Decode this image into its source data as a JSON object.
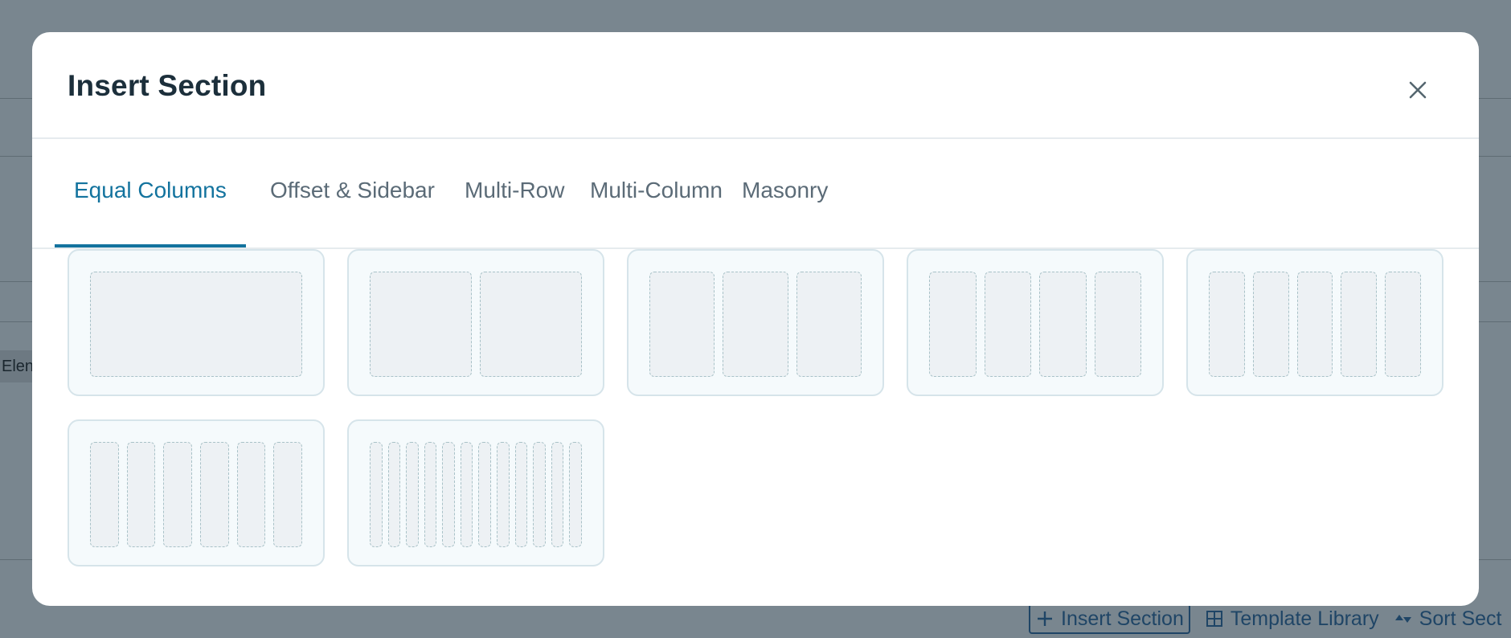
{
  "background": {
    "partial_text": "Elen",
    "bottom_bar": {
      "insert_section": "Insert Section",
      "template_library": "Template Library",
      "sort_sections": "Sort Sect"
    }
  },
  "modal": {
    "title": "Insert Section",
    "close_icon": "close-icon",
    "tabs": [
      {
        "label": "Equal Columns",
        "active": true
      },
      {
        "label": "Offset & Sidebar",
        "active": false
      },
      {
        "label": "Multi-Row",
        "active": false
      },
      {
        "label": "Multi-Column",
        "active": false
      },
      {
        "label": "Masonry",
        "active": false
      }
    ],
    "layouts": [
      {
        "columns": 1
      },
      {
        "columns": 2
      },
      {
        "columns": 3
      },
      {
        "columns": 4
      },
      {
        "columns": 5
      },
      {
        "columns": 6
      },
      {
        "columns": 12
      }
    ]
  },
  "colors": {
    "accent": "#13739e",
    "title": "#1c2f3b",
    "tab_text": "#5b6b77",
    "overlay": "#79868f"
  }
}
